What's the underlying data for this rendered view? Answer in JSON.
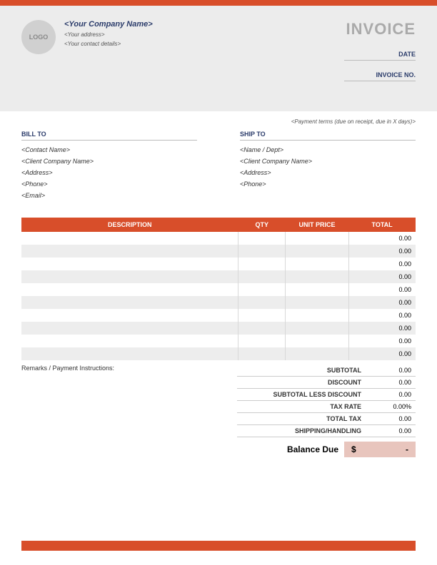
{
  "logo_text": "LOGO",
  "company": {
    "name": "<Your Company Name>",
    "address": "<Your address>",
    "contact": "<Your contact details>"
  },
  "invoice_title": "INVOICE",
  "meta": {
    "date_label": "DATE",
    "invoice_no_label": "INVOICE NO."
  },
  "payment_terms": "<Payment terms (due on receipt, due in X days)>",
  "bill_to": {
    "header": "BILL TO",
    "contact": "<Contact Name>",
    "company": "<Client Company Name>",
    "address": "<Address>",
    "phone": "<Phone>",
    "email": "<Email>"
  },
  "ship_to": {
    "header": "SHIP TO",
    "name": "<Name / Dept>",
    "company": "<Client Company Name>",
    "address": "<Address>",
    "phone": "<Phone>"
  },
  "table": {
    "headers": {
      "desc": "DESCRIPTION",
      "qty": "QTY",
      "price": "UNIT PRICE",
      "total": "TOTAL"
    },
    "rows": [
      {
        "total": "0.00"
      },
      {
        "total": "0.00"
      },
      {
        "total": "0.00"
      },
      {
        "total": "0.00"
      },
      {
        "total": "0.00"
      },
      {
        "total": "0.00"
      },
      {
        "total": "0.00"
      },
      {
        "total": "0.00"
      },
      {
        "total": "0.00"
      },
      {
        "total": "0.00"
      }
    ]
  },
  "remarks_label": "Remarks / Payment Instructions:",
  "totals": {
    "subtotal_label": "SUBTOTAL",
    "subtotal": "0.00",
    "discount_label": "DISCOUNT",
    "discount": "0.00",
    "less_discount_label": "SUBTOTAL LESS DISCOUNT",
    "less_discount": "0.00",
    "tax_rate_label": "TAX RATE",
    "tax_rate": "0.00%",
    "total_tax_label": "TOTAL TAX",
    "total_tax": "0.00",
    "shipping_label": "SHIPPING/HANDLING",
    "shipping": "0.00"
  },
  "balance": {
    "label": "Balance Due",
    "currency": "$",
    "amount": "-"
  }
}
